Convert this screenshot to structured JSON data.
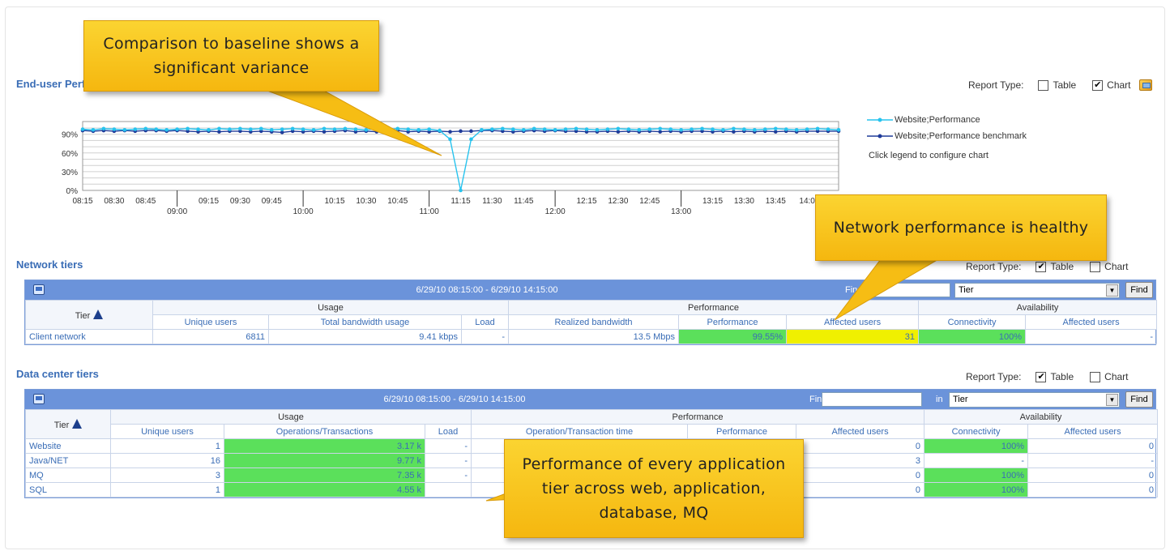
{
  "callouts": {
    "baseline": "Comparison to baseline shows a significant variance",
    "network": "Network performance is healthy",
    "tiers": "Performance of every application tier across web, application, database, MQ"
  },
  "enduser": {
    "title": "End-user Performance",
    "report_type": {
      "label": "Report Type:",
      "table": "Table",
      "chart": "Chart",
      "table_checked": false,
      "chart_checked": true
    },
    "legend": [
      {
        "name": "Website;Performance",
        "color": "#27c3ee"
      },
      {
        "name": "Website;Performance benchmark",
        "color": "#1f3b99"
      }
    ],
    "legend_hint": "Click legend to configure chart"
  },
  "chart_data": {
    "type": "line",
    "y_ticks": [
      "0%",
      "30%",
      "60%",
      "90%"
    ],
    "ylim": [
      0,
      100
    ],
    "x_minor_ticks": [
      "08:15",
      "08:30",
      "08:45",
      "09:15",
      "09:30",
      "09:45",
      "10:15",
      "10:30",
      "10:45",
      "11:15",
      "11:30",
      "11:45",
      "12:15",
      "12:30",
      "12:45",
      "13:15",
      "13:30",
      "13:45",
      "14:0"
    ],
    "x_major_ticks": [
      "09:00",
      "10:00",
      "11:00",
      "12:00",
      "13:00"
    ],
    "x": [
      "08:15",
      "08:20",
      "08:25",
      "08:30",
      "08:35",
      "08:40",
      "08:45",
      "08:50",
      "08:55",
      "09:00",
      "09:05",
      "09:10",
      "09:15",
      "09:20",
      "09:25",
      "09:30",
      "09:35",
      "09:40",
      "09:45",
      "09:50",
      "09:55",
      "10:00",
      "10:05",
      "10:10",
      "10:15",
      "10:20",
      "10:25",
      "10:30",
      "10:35",
      "10:40",
      "10:45",
      "10:50",
      "10:55",
      "11:00",
      "11:05",
      "11:10",
      "11:15",
      "11:20",
      "11:25",
      "11:30",
      "11:35",
      "11:40",
      "11:45",
      "11:50",
      "11:55",
      "12:00",
      "12:05",
      "12:10",
      "12:15",
      "12:20",
      "12:25",
      "12:30",
      "12:35",
      "12:40",
      "12:45",
      "12:50",
      "12:55",
      "13:00",
      "13:05",
      "13:10",
      "13:15",
      "13:20",
      "13:25",
      "13:30",
      "13:35",
      "13:40",
      "13:45",
      "13:50",
      "13:55",
      "14:00",
      "14:05",
      "14:10",
      "14:15"
    ],
    "series": [
      {
        "name": "Website;Performance",
        "color": "#27c3ee",
        "values": [
          98,
          97,
          99,
          98,
          97,
          98,
          99,
          98,
          97,
          98,
          99,
          98,
          97,
          99,
          98,
          99,
          98,
          99,
          97,
          98,
          99,
          98,
          97,
          99,
          98,
          99,
          98,
          97,
          99,
          98,
          99,
          98,
          97,
          98,
          96,
          82,
          0,
          82,
          97,
          98,
          99,
          98,
          97,
          99,
          98,
          97,
          98,
          99,
          98,
          97,
          98,
          99,
          98,
          97,
          98,
          99,
          98,
          97,
          98,
          99,
          98,
          97,
          99,
          98,
          97,
          98,
          99,
          98,
          97,
          98,
          99,
          98,
          97
        ]
      },
      {
        "name": "Website;Performance benchmark",
        "color": "#1f3b99",
        "values": [
          96,
          95,
          96,
          95,
          96,
          95,
          96,
          96,
          95,
          96,
          95,
          94,
          95,
          94,
          95,
          95,
          94,
          95,
          94,
          93,
          95,
          94,
          95,
          94,
          95,
          96,
          94,
          95,
          94,
          95,
          96,
          94,
          95,
          94,
          95,
          94,
          95,
          95,
          96,
          96,
          95,
          94,
          95,
          96,
          95,
          96,
          95,
          95,
          94,
          94,
          95,
          94,
          95,
          94,
          95,
          94,
          95,
          94,
          95,
          95,
          94,
          95,
          94,
          95,
          94,
          95,
          94,
          95,
          94,
          95,
          95,
          95,
          95
        ]
      }
    ],
    "grid": true
  },
  "network": {
    "title": "Network tiers",
    "report_type": {
      "label": "Report Type:",
      "table": "Table",
      "chart": "Chart"
    },
    "period": "6/29/10 08:15:00 - 6/29/10 14:15:00",
    "find_label": "Find:",
    "in_label": "in",
    "select_value": "Tier",
    "find_button": "Find",
    "groups": {
      "tier": "Tier",
      "usage": "Usage",
      "performance": "Performance",
      "availability": "Availability"
    },
    "columns": [
      "Unique users",
      "Total bandwidth usage",
      "Load",
      "Realized bandwidth",
      "Performance",
      "Affected users",
      "Connectivity",
      "Affected users"
    ],
    "rows": [
      {
        "name": "Client network",
        "unique_users": "6811",
        "bandwidth": "9.41 kbps",
        "load": "-",
        "realized": "13.5 Mbps",
        "performance": "99.55%",
        "affected": "31",
        "connectivity": "100%",
        "avail_affected": "-"
      }
    ]
  },
  "datacenter": {
    "title": "Data center tiers",
    "report_type": {
      "label": "Report Type:",
      "table": "Table",
      "chart": "Chart"
    },
    "period": "6/29/10 08:15:00 - 6/29/10 14:15:00",
    "find_label": "Find:",
    "in_label": "in",
    "select_value": "Tier",
    "find_button": "Find",
    "groups": {
      "tier": "Tier",
      "usage": "Usage",
      "performance": "Performance",
      "availability": "Availability"
    },
    "columns": [
      "Unique users",
      "Operations/Transactions",
      "Load",
      "Operation/Transaction time",
      "Performance",
      "Affected users",
      "Connectivity",
      "Affected users"
    ],
    "rows": [
      {
        "name": "Website",
        "unique_users": "1",
        "ops": "3.17 k",
        "load": "-",
        "affected": "0",
        "connectivity": "100%",
        "avail_affected": "0"
      },
      {
        "name": "Java/NET",
        "unique_users": "16",
        "ops": "9.77 k",
        "load": "-",
        "affected": "3",
        "connectivity": "-",
        "avail_affected": "-"
      },
      {
        "name": "MQ",
        "unique_users": "3",
        "ops": "7.35 k",
        "load": "-",
        "affected": "0",
        "connectivity": "100%",
        "avail_affected": "0"
      },
      {
        "name": "SQL",
        "unique_users": "1",
        "ops": "4.55 k",
        "load": "",
        "affected": "0",
        "connectivity": "100%",
        "avail_affected": "0"
      }
    ]
  }
}
